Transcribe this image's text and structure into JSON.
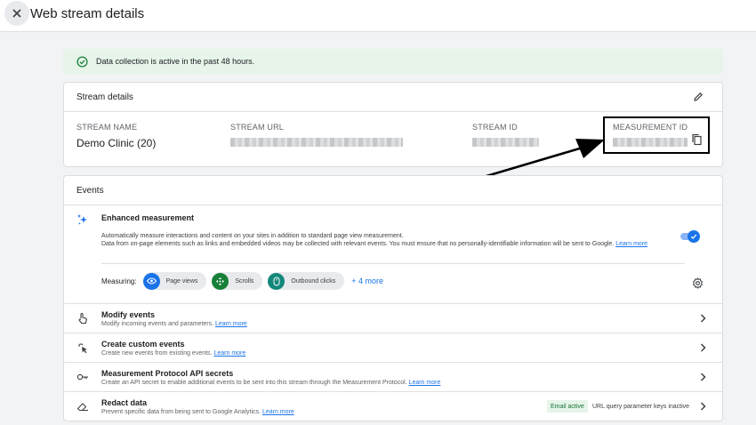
{
  "header": {
    "title": "Web stream details"
  },
  "banner": {
    "text": "Data collection is active in the past 48 hours."
  },
  "stream_details": {
    "title": "Stream details",
    "name_label": "STREAM NAME",
    "name_value": "Demo Clinic (20)",
    "url_label": "STREAM URL",
    "id_label": "STREAM ID",
    "measurement_label": "MEASUREMENT ID"
  },
  "events": {
    "title": "Events",
    "enhanced": {
      "title": "Enhanced measurement",
      "desc1": "Automatically measure interactions and content on your sites in addition to standard page view measurement.",
      "desc2": "Data from on-page elements such as links and embedded videos may be collected with relevant events. You must ensure that no personally-identifiable information will be sent to Google.",
      "learn_more": "Learn more",
      "measuring_label": "Measuring:",
      "chips": [
        "Page views",
        "Scrolls",
        "Outbound clicks"
      ],
      "more": "+ 4 more"
    },
    "rows": [
      {
        "title": "Modify events",
        "sub": "Modify incoming events and parameters.",
        "link": "Learn more"
      },
      {
        "title": "Create custom events",
        "sub": "Create new events from existing events.",
        "link": "Learn more"
      },
      {
        "title": "Measurement Protocol API secrets",
        "sub": "Create an API secret to enable additional events to be sent into this stream through the Measurement Protocol.",
        "link": "Learn more"
      },
      {
        "title": "Redact data",
        "sub": "Prevent specific data from being sent to Google Analytics.",
        "link": "Learn more",
        "badge_active": "Email active",
        "badge_inactive": "URL query parameter keys inactive"
      }
    ]
  },
  "colors": {
    "accent": "#1a73e8",
    "success": "#188038",
    "banner_bg": "#e6f4ea",
    "teal": "#12877a"
  }
}
